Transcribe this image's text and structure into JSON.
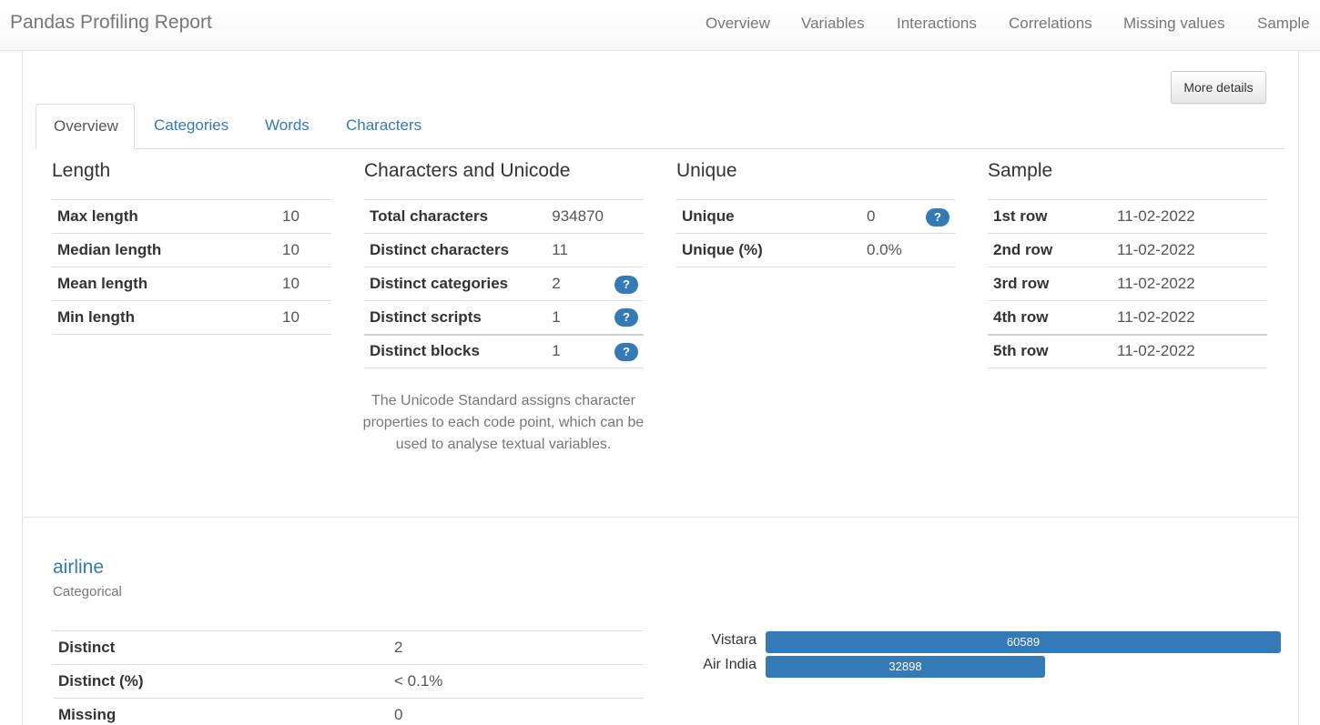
{
  "navbar": {
    "brand": "Pandas Profiling Report",
    "links": [
      "Overview",
      "Variables",
      "Interactions",
      "Correlations",
      "Missing values",
      "Sample"
    ]
  },
  "more_details_label": "More details",
  "tabs": [
    "Overview",
    "Categories",
    "Words",
    "Characters"
  ],
  "length": {
    "title": "Length",
    "rows": [
      {
        "label": "Max length",
        "value": "10"
      },
      {
        "label": "Median length",
        "value": "10"
      },
      {
        "label": "Mean length",
        "value": "10"
      },
      {
        "label": "Min length",
        "value": "10"
      }
    ]
  },
  "unicode": {
    "title": "Characters and Unicode",
    "rows": [
      {
        "label": "Total characters",
        "value": "934870"
      },
      {
        "label": "Distinct characters",
        "value": "11"
      },
      {
        "label": "Distinct categories",
        "value": "2",
        "help": "?"
      },
      {
        "label": "Distinct scripts",
        "value": "1",
        "help": "?"
      },
      {
        "label": "Distinct blocks",
        "value": "1",
        "help": "?"
      }
    ],
    "note": "The Unicode Standard assigns character properties to each code point, which can be used to analyse textual variables."
  },
  "unique": {
    "title": "Unique",
    "rows": [
      {
        "label": "Unique",
        "value": "0",
        "help": "?"
      },
      {
        "label": "Unique (%)",
        "value": "0.0%"
      }
    ]
  },
  "sample": {
    "title": "Sample",
    "rows": [
      {
        "label": "1st row",
        "value": "11-02-2022"
      },
      {
        "label": "2nd row",
        "value": "11-02-2022"
      },
      {
        "label": "3rd row",
        "value": "11-02-2022"
      },
      {
        "label": "4th row",
        "value": "11-02-2022"
      },
      {
        "label": "5th row",
        "value": "11-02-2022"
      }
    ]
  },
  "airline": {
    "name": "airline",
    "type": "Categorical",
    "rows": [
      {
        "label": "Distinct",
        "value": "2"
      },
      {
        "label": "Distinct (%)",
        "value": "< 0.1%"
      },
      {
        "label": "Missing",
        "value": "0"
      }
    ]
  },
  "chart_data": {
    "type": "bar",
    "orientation": "horizontal",
    "categories": [
      "Vistara",
      "Air India"
    ],
    "values": [
      60589,
      32898
    ],
    "value_labels": [
      "60589",
      "32898"
    ],
    "color": "#337ab7"
  },
  "colors": {
    "accent": "#337ab7",
    "muted": "#777777"
  }
}
